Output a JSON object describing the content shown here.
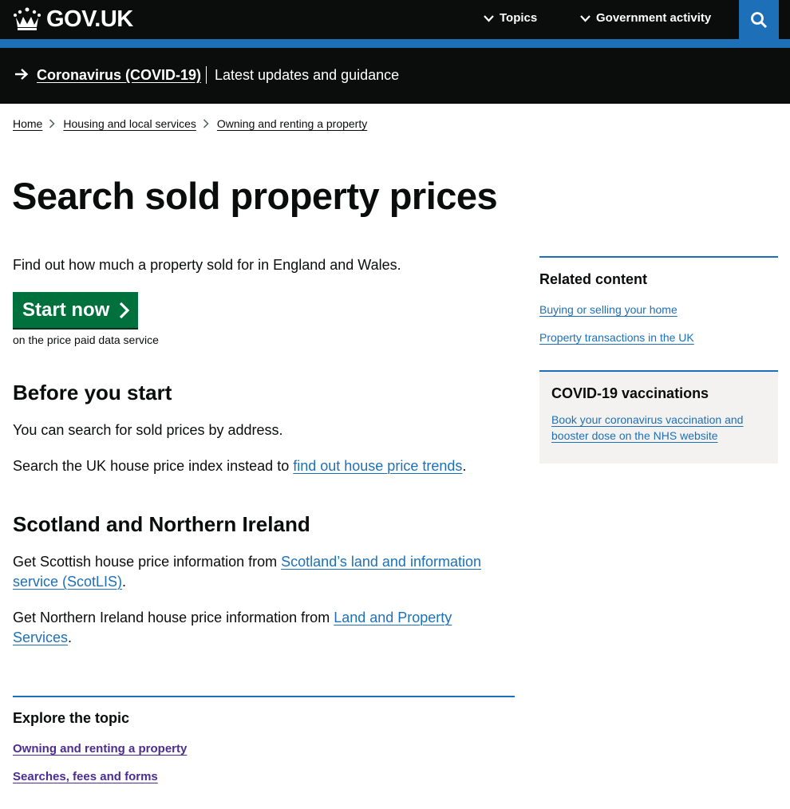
{
  "header": {
    "logo_text": "GOV.UK",
    "nav": [
      {
        "label": "Topics"
      },
      {
        "label": "Government activity"
      }
    ],
    "search_icon": "search-icon"
  },
  "banner": {
    "link": "Coronavirus (COVID-19)",
    "text": "Latest updates and guidance"
  },
  "breadcrumbs": [
    "Home",
    "Housing and local services",
    "Owning and renting a property"
  ],
  "page": {
    "title": "Search sold property prices",
    "lead": "Find out how much a property sold for in England and Wales.",
    "start_button": "Start now",
    "start_caption": "on the price paid data service"
  },
  "before": {
    "heading": "Before you start",
    "p1": "You can search for sold prices by address.",
    "p2_prefix": "Search the UK house price index instead to ",
    "p2_link": "find out house price trends",
    "p2_suffix": "."
  },
  "scotland": {
    "heading": "Scotland and Northern Ireland",
    "p1_prefix": "Get Scottish house price information from ",
    "p1_link": "Scotland’s land and information service (ScotLIS)",
    "p1_suffix": ".",
    "p2_prefix": "Get Northern Ireland house price information from ",
    "p2_link": "Land and Property Services",
    "p2_suffix": "."
  },
  "explore": {
    "heading": "Explore the topic",
    "links": [
      "Owning and renting a property",
      "Searches, fees and forms"
    ]
  },
  "related": {
    "heading": "Related content",
    "links": [
      "Buying or selling your home",
      "Property transactions in the UK"
    ]
  },
  "covid_box": {
    "heading": "COVID-19 vaccinations",
    "link": "Book your coronavirus vaccination and booster dose on the NHS website"
  },
  "colors": {
    "header_black": "#0b0c0c",
    "brand_blue": "#1d70b8",
    "start_green": "#00703c",
    "visited_purple": "#4c2c92",
    "panel_grey": "#f3f2f1"
  }
}
